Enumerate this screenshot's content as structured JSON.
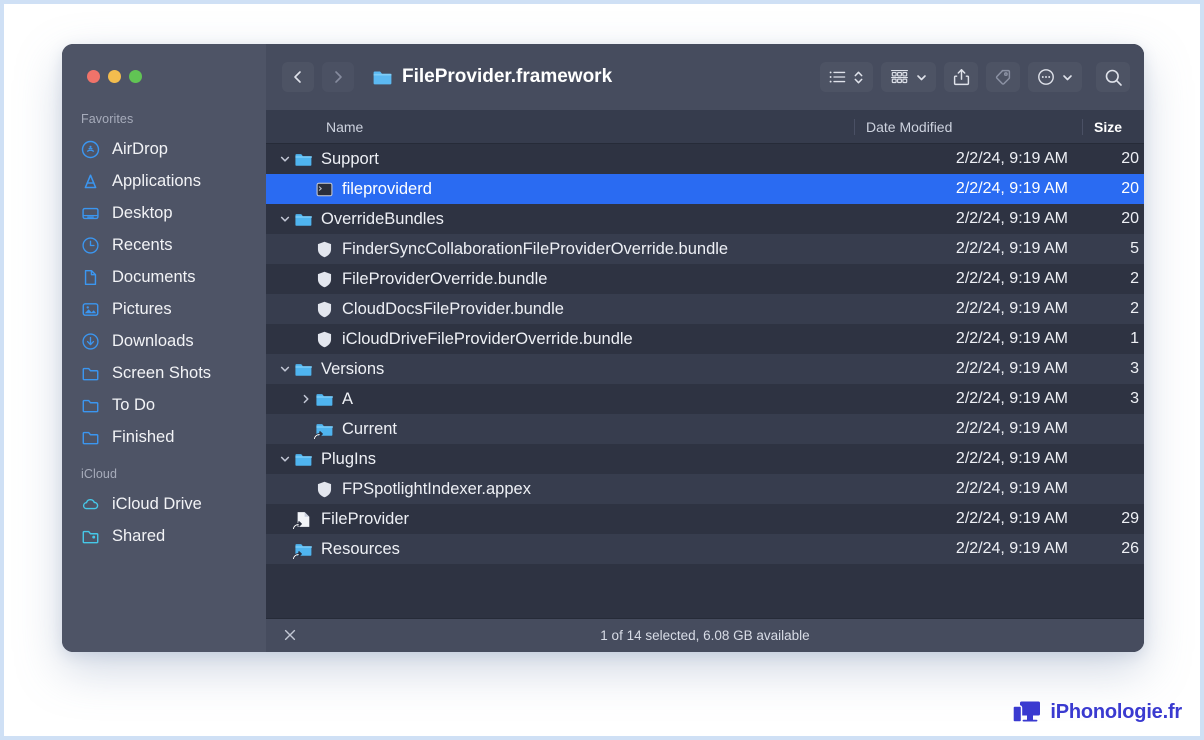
{
  "window": {
    "traffic_lights": [
      "close",
      "minimize",
      "maximize"
    ],
    "title": "FileProvider.framework"
  },
  "sidebar": {
    "sections": [
      {
        "label": "Favorites",
        "items": [
          {
            "label": "AirDrop",
            "icon": "airdrop-icon"
          },
          {
            "label": "Applications",
            "icon": "applications-icon"
          },
          {
            "label": "Desktop",
            "icon": "desktop-icon"
          },
          {
            "label": "Recents",
            "icon": "clock-icon"
          },
          {
            "label": "Documents",
            "icon": "document-icon"
          },
          {
            "label": "Pictures",
            "icon": "pictures-icon"
          },
          {
            "label": "Downloads",
            "icon": "downloads-icon"
          },
          {
            "label": "Screen Shots",
            "icon": "folder-outline-icon"
          },
          {
            "label": "To Do",
            "icon": "folder-outline-icon"
          },
          {
            "label": "Finished",
            "icon": "folder-outline-icon"
          }
        ]
      },
      {
        "label": "iCloud",
        "items": [
          {
            "label": "iCloud Drive",
            "icon": "cloud-icon"
          },
          {
            "label": "Shared",
            "icon": "folder-shared-icon"
          }
        ]
      }
    ]
  },
  "toolbar": {
    "back_label": "Back",
    "forward_label": "Forward",
    "view_toggle_label": "List View",
    "group_by_label": "Group By",
    "share_label": "Share",
    "tags_label": "Tags",
    "more_label": "More Actions",
    "search_label": "Search"
  },
  "columns": {
    "name": "Name",
    "date_modified": "Date Modified",
    "size": "Size"
  },
  "files": [
    {
      "name": "Support",
      "date": "2/2/24, 9:19 AM",
      "size": "20",
      "icon": "folder-icon",
      "indent": 0,
      "twist": "open",
      "selected": false,
      "alias": false
    },
    {
      "name": "fileproviderd",
      "date": "2/2/24, 9:19 AM",
      "size": "20",
      "icon": "unix-exec-icon",
      "indent": 1,
      "twist": "none",
      "selected": true,
      "alias": false
    },
    {
      "name": "OverrideBundles",
      "date": "2/2/24, 9:19 AM",
      "size": "20",
      "icon": "folder-icon",
      "indent": 0,
      "twist": "open",
      "selected": false,
      "alias": false
    },
    {
      "name": "FinderSyncCollaborationFileProviderOverride.bundle",
      "date": "2/2/24, 9:19 AM",
      "size": "5",
      "icon": "bundle-icon",
      "indent": 1,
      "twist": "none",
      "selected": false,
      "alias": false
    },
    {
      "name": "FileProviderOverride.bundle",
      "date": "2/2/24, 9:19 AM",
      "size": "2",
      "icon": "bundle-icon",
      "indent": 1,
      "twist": "none",
      "selected": false,
      "alias": false
    },
    {
      "name": "CloudDocsFileProvider.bundle",
      "date": "2/2/24, 9:19 AM",
      "size": "2",
      "icon": "bundle-icon",
      "indent": 1,
      "twist": "none",
      "selected": false,
      "alias": false
    },
    {
      "name": "iCloudDriveFileProviderOverride.bundle",
      "date": "2/2/24, 9:19 AM",
      "size": "1",
      "icon": "bundle-icon",
      "indent": 1,
      "twist": "none",
      "selected": false,
      "alias": false
    },
    {
      "name": "Versions",
      "date": "2/2/24, 9:19 AM",
      "size": "3",
      "icon": "folder-icon",
      "indent": 0,
      "twist": "open",
      "selected": false,
      "alias": false
    },
    {
      "name": "A",
      "date": "2/2/24, 9:19 AM",
      "size": "3",
      "icon": "folder-icon",
      "indent": 1,
      "twist": "closed",
      "selected": false,
      "alias": false
    },
    {
      "name": "Current",
      "date": "2/2/24, 9:19 AM",
      "size": "",
      "icon": "folder-icon",
      "indent": 1,
      "twist": "none",
      "selected": false,
      "alias": true
    },
    {
      "name": "PlugIns",
      "date": "2/2/24, 9:19 AM",
      "size": "",
      "icon": "folder-icon",
      "indent": 0,
      "twist": "open",
      "selected": false,
      "alias": false
    },
    {
      "name": "FPSpotlightIndexer.appex",
      "date": "2/2/24, 9:19 AM",
      "size": "",
      "icon": "bundle-icon",
      "indent": 1,
      "twist": "none",
      "selected": false,
      "alias": false
    },
    {
      "name": "FileProvider",
      "date": "2/2/24, 9:19 AM",
      "size": "29",
      "icon": "doc-alias-icon",
      "indent": 0,
      "twist": "none",
      "selected": false,
      "alias": true
    },
    {
      "name": "Resources",
      "date": "2/2/24, 9:19 AM",
      "size": "26",
      "icon": "folder-icon",
      "indent": 0,
      "twist": "none",
      "selected": false,
      "alias": true
    }
  ],
  "status": {
    "close_label": "Close",
    "text": "1 of 14 selected, 6.08 GB available"
  },
  "watermark": {
    "text": "iPhonologie.fr",
    "icon": "monitor-phone-icon",
    "color": "#3a3ad0"
  },
  "colors": {
    "selection_blue": "#2a6bf2",
    "folder_blue": "#58b8f0",
    "sidebar_bg": "#4e5466",
    "list_bg": "#2e3342",
    "toolbar_bg": "#464c5e"
  }
}
